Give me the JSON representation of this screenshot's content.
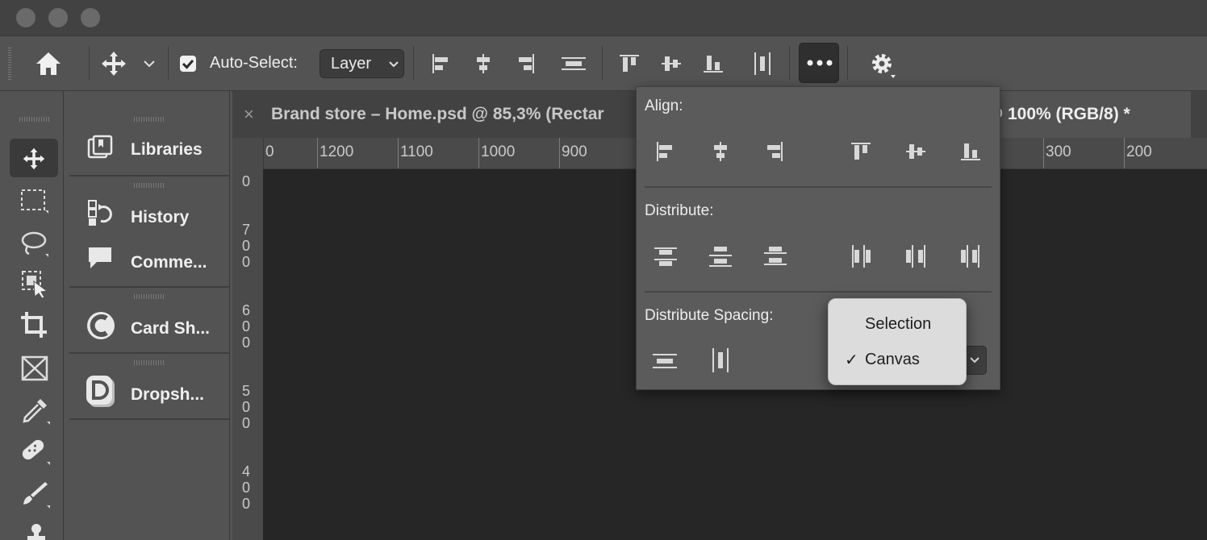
{
  "window": {
    "traffic_lights": [
      "close",
      "minimize",
      "zoom"
    ]
  },
  "options_bar": {
    "home_icon": "home-icon",
    "move_tool_icon": "move-icon",
    "auto_select_checked": true,
    "auto_select_label": "Auto-Select:",
    "auto_select_value": "Layer",
    "more_icon": "ellipsis-icon",
    "settings_icon": "gear-icon"
  },
  "panel_collapse": {
    "left": "»",
    "right": "»"
  },
  "tools": [
    "move",
    "rectangular-marquee",
    "lasso",
    "object-selection",
    "crop",
    "frame",
    "eyedropper",
    "healing-brush",
    "brush",
    "clone-stamp"
  ],
  "panels": [
    {
      "label": "Libraries",
      "icon": "libraries-icon"
    },
    {
      "label": "History",
      "icon": "history-icon"
    },
    {
      "label": "Comme...",
      "icon": "comments-icon"
    },
    {
      "label": "Card Sh...",
      "icon": "card-sharing-plugin-icon"
    },
    {
      "label": "Dropsh...",
      "icon": "dropshadow-plugin-icon"
    }
  ],
  "tabs": [
    {
      "close": "×",
      "title": "Brand store – Home.psd @ 85,3% (Rectar"
    },
    {
      "title": "p @ 100% (RGB/8) *"
    }
  ],
  "ruler": {
    "horizontal": [
      "0",
      "1200",
      "1100",
      "1000",
      "900",
      "300",
      "200"
    ],
    "vertical": [
      [
        "0"
      ],
      [
        "7",
        "0",
        "0"
      ],
      [
        "6",
        "0",
        "0"
      ],
      [
        "5",
        "0",
        "0"
      ],
      [
        "4",
        "0",
        "0"
      ]
    ]
  },
  "popover": {
    "align_label": "Align:",
    "distribute_label": "Distribute:",
    "spacing_label": "Distribute Spacing:",
    "spacing_options": [
      {
        "label": "Selection",
        "checked": false
      },
      {
        "label": "Canvas",
        "checked": true
      }
    ],
    "check_mark": "✓"
  }
}
